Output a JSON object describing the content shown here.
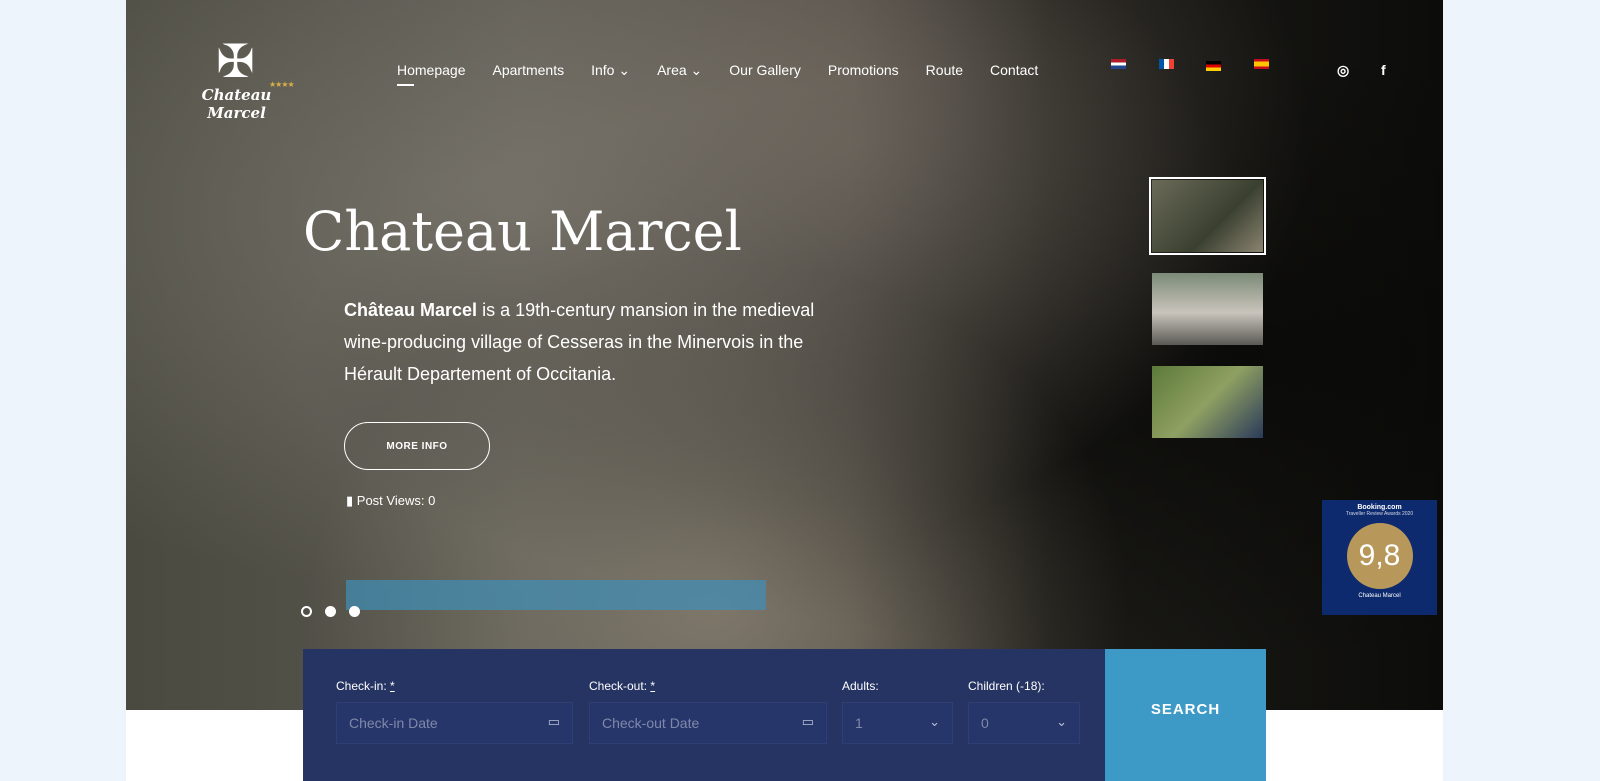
{
  "logo": {
    "name": "Chateau Marcel",
    "stars": "★★★★",
    "icon": "occitan-cross-icon"
  },
  "nav": [
    {
      "label": "Homepage",
      "active": true
    },
    {
      "label": "Apartments"
    },
    {
      "label": "Info",
      "dropdown": true
    },
    {
      "label": "Area",
      "dropdown": true
    },
    {
      "label": "Our Gallery"
    },
    {
      "label": "Promotions"
    },
    {
      "label": "Route"
    },
    {
      "label": "Contact"
    }
  ],
  "languages": [
    "Dutch",
    "French",
    "German",
    "Spanish"
  ],
  "social": [
    "instagram-icon",
    "facebook-icon"
  ],
  "hero": {
    "title": "Chateau Marcel",
    "desc_bold": "Château Marcel",
    "desc_rest": " is a 19th-century mansion in the medieval wine-producing village of Cesseras in the Minervois in the Hérault Departement of Occitania.",
    "more_label": "MORE INFO",
    "views": "Post Views: 0",
    "slides": 3,
    "active_slide": 1
  },
  "badge": {
    "brand": "Booking.com",
    "award": "Traveller Review Awards 2020",
    "score": "9,8",
    "name": "Chateau Marcel"
  },
  "booking": {
    "checkin_label": "Check-in:",
    "checkin_placeholder": "Check-in Date",
    "checkout_label": "Check-out:",
    "checkout_placeholder": "Check-out Date",
    "required": "*",
    "adults_label": "Adults:",
    "adults_value": "1",
    "children_label": "Children (-18):",
    "children_value": "0",
    "search_label": "SEARCH"
  },
  "colors": {
    "form_bg": "#253463",
    "search_bg": "#3d9ac6",
    "badge_bg": "#0e2a6e"
  }
}
